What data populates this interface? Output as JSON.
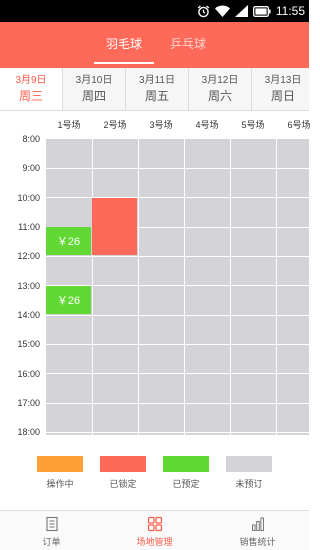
{
  "status_bar": {
    "time": "11:55"
  },
  "header": {
    "tabs": [
      {
        "label": "羽毛球",
        "active": true
      },
      {
        "label": "乒乓球",
        "active": false
      }
    ]
  },
  "dates": [
    {
      "date": "3月9日",
      "weekday": "周三",
      "active": true
    },
    {
      "date": "3月10日",
      "weekday": "周四",
      "active": false
    },
    {
      "date": "3月11日",
      "weekday": "周五",
      "active": false
    },
    {
      "date": "3月12日",
      "weekday": "周六",
      "active": false
    },
    {
      "date": "3月13日",
      "weekday": "周日",
      "active": false
    }
  ],
  "courts": [
    "1号场",
    "2号场",
    "3号场",
    "4号场",
    "5号场",
    "6号场"
  ],
  "times": [
    "8:00",
    "9:00",
    "10:00",
    "11:00",
    "12:00",
    "13:00",
    "14:00",
    "15:00",
    "16:00",
    "17:00",
    "18:00"
  ],
  "slots": [
    {
      "court": 1,
      "start": 11,
      "end": 12,
      "status": "booked",
      "price": "￥26"
    },
    {
      "court": 1,
      "start": 13,
      "end": 14,
      "status": "booked",
      "price": "￥26"
    },
    {
      "court": 2,
      "start": 10,
      "end": 12,
      "status": "locked",
      "price": ""
    }
  ],
  "legend": [
    {
      "label": "操作中",
      "color": "#ffa035"
    },
    {
      "label": "已锁定",
      "color": "#fe6a5a"
    },
    {
      "label": "已预定",
      "color": "#62d835"
    },
    {
      "label": "未预订",
      "color": "#d4d3d8"
    }
  ],
  "bottom_nav": [
    {
      "label": "订单",
      "icon": "order-icon",
      "active": false
    },
    {
      "label": "场地管理",
      "icon": "grid-icon",
      "active": true
    },
    {
      "label": "销售统计",
      "icon": "bar-chart-icon",
      "active": false
    }
  ]
}
